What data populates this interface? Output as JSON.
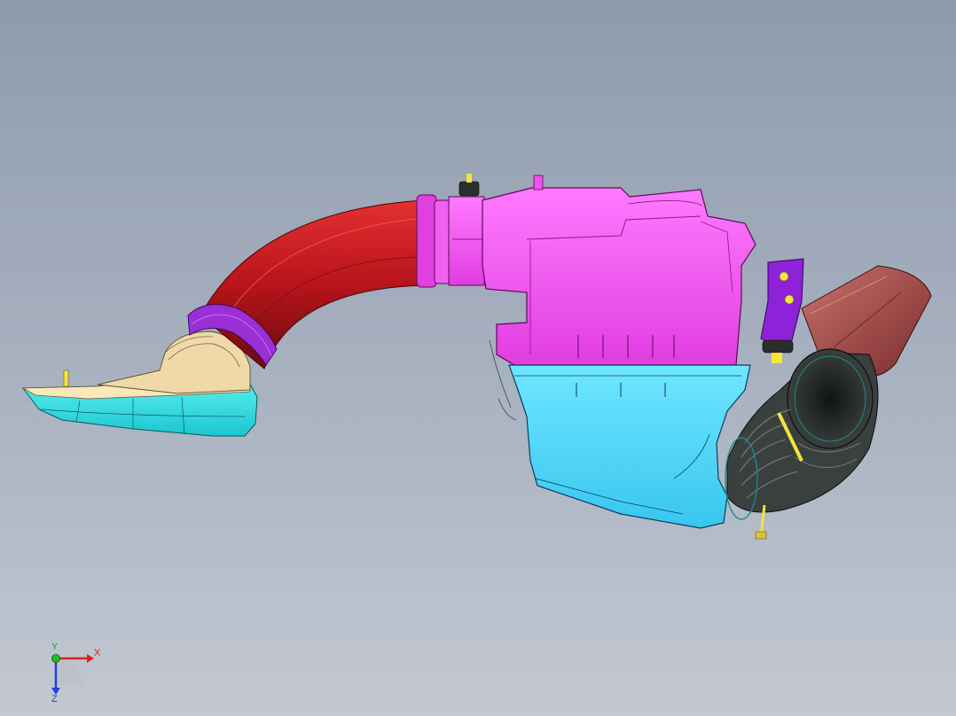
{
  "viewport": {
    "background_top": "#8f9bad",
    "background_bottom": "#c3c8d2"
  },
  "model": {
    "parts": [
      {
        "name": "intake-scoop",
        "color": "#33e0e6"
      },
      {
        "name": "scoop-inner",
        "color": "#efd9a8"
      },
      {
        "name": "intake-duct-pipe",
        "color": "#c0141c"
      },
      {
        "name": "duct-coupler",
        "color": "#9b2fd6"
      },
      {
        "name": "airbox-upper-housing",
        "color": "#f050f0"
      },
      {
        "name": "airbox-lower-housing",
        "color": "#4fd8f8"
      },
      {
        "name": "mounting-bracket",
        "color": "#8e22d8"
      },
      {
        "name": "corrugated-hose",
        "color": "#2a2f2e"
      },
      {
        "name": "resonator-duct",
        "color": "#a24a48"
      },
      {
        "name": "hose-clamp-screw",
        "color": "#f5e43a"
      }
    ]
  },
  "triad": {
    "x_label": "X",
    "y_label": "Y",
    "z_label": "Z",
    "x_color": "#e02020",
    "y_color": "#20c020",
    "z_color": "#2040e0"
  }
}
